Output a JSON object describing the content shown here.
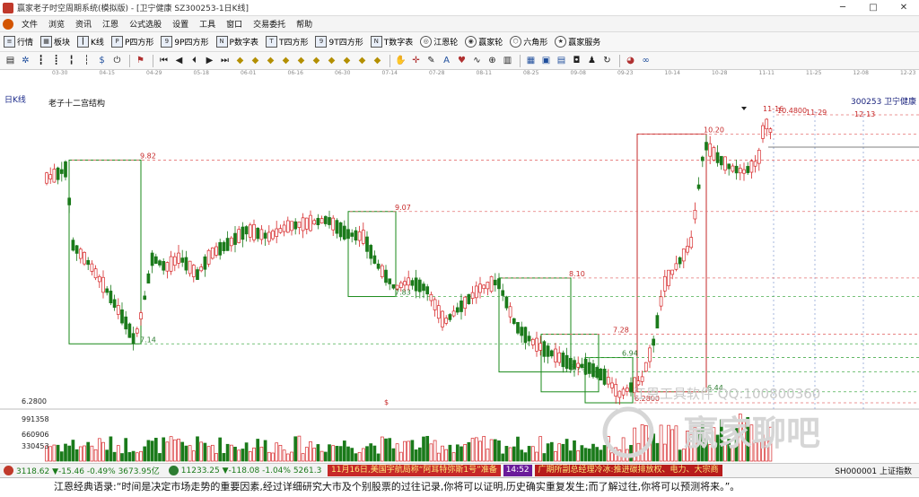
{
  "window": {
    "title": "赢家老子时空周期系统(模拟版) - [卫宁健康  SZ300253-1日K线]",
    "min_label": "─",
    "max_label": "□",
    "close_label": "✕"
  },
  "menu": [
    "文件",
    "浏览",
    "资讯",
    "江恩",
    "公式选股",
    "设置",
    "工具",
    "窗口",
    "交易委托",
    "帮助"
  ],
  "toolbar": [
    {
      "icon": "list-icon",
      "label": "行情"
    },
    {
      "icon": "grid-icon",
      "label": "板块"
    },
    {
      "icon": "candle-icon",
      "label": "K线"
    },
    {
      "icon": "p-box-icon",
      "label": "P四方形"
    },
    {
      "icon": "p9-box-icon",
      "label": "9P四方形"
    },
    {
      "icon": "pn-box-icon",
      "label": "P数字表"
    },
    {
      "icon": "t-box-icon",
      "label": "T四方形"
    },
    {
      "icon": "t9-box-icon",
      "label": "9T四方形"
    },
    {
      "icon": "tn-box-icon",
      "label": "T数字表"
    },
    {
      "icon": "gann-wheel-icon",
      "label": "江恩轮"
    },
    {
      "icon": "winner-wheel-icon",
      "label": "赢家轮"
    },
    {
      "icon": "hexagon-icon",
      "label": "六角形"
    },
    {
      "icon": "service-icon",
      "label": "赢家服务"
    }
  ],
  "chart_header": {
    "period_label": "日K线",
    "indicator_title": "老子十二宫结构",
    "stock_code": "300253",
    "stock_name": "卫宁健康",
    "vol_value": "6.2800"
  },
  "date_axis": [
    "03-30",
    "04-15",
    "04-29",
    "05-18",
    "06-01",
    "06-16",
    "06-30",
    "07-14",
    "07-28",
    "08-11",
    "08-25",
    "09-08",
    "09-23",
    "10-14",
    "10-28",
    "11-11",
    "11-25",
    "12-08",
    "12-23"
  ],
  "volume_axis": [
    "6.2800",
    "991358",
    "660906",
    "330453"
  ],
  "status": {
    "sh_index": "3118.62 ▼-15.46 -0.49% 3673.95亿",
    "sz_index": "11233.25 ▼-118.08 -1.04% 5261.3",
    "news_1": "11月16日,美国宇航局称“阿耳特弥斯1号”准备",
    "news_time": "14:52",
    "news_2": "广期所副总经理冷冰:推进碳排放权、电力、大宗商",
    "right": "SH000001 上证指数"
  },
  "quote": "江恩经典语录:“时间是决定市场走势的重要因素,经过详细研究大市及个别股票的过往记录,你将可以证明,历史确实重复发生;而了解过往,你将可以预测将来。”。",
  "watermark": {
    "top": "江恩工具软件  QQ:100800360",
    "brand": "赢家聊吧"
  },
  "chart_data": {
    "type": "candlestick",
    "series_color_up": "#d62728",
    "series_color_down": "#1a7a1a",
    "price_range": [
      6.28,
      10.9
    ],
    "boxes": [
      {
        "high": 9.82,
        "low": 7.14,
        "color": "#1a8a1a"
      },
      {
        "high": 9.07,
        "low": 7.83,
        "color": "#1a8a1a"
      },
      {
        "high": 8.1,
        "low": 6.73,
        "color": "#1a8a1a"
      },
      {
        "high": 7.28,
        "low": 6.44,
        "color": "#1a8a1a"
      },
      {
        "high": 6.94,
        "low": 6.28,
        "color": "#1a8a1a"
      },
      {
        "high": 10.2,
        "low": 6.44,
        "color": "#c62828"
      }
    ],
    "levels": [
      {
        "value": 9.82,
        "label": "9.82"
      },
      {
        "value": 9.07,
        "label": "9.07"
      },
      {
        "value": 8.1,
        "label": "8.10"
      },
      {
        "value": 7.28,
        "label": "7.28"
      },
      {
        "value": 7.14,
        "label": "7.14"
      },
      {
        "value": 6.94,
        "label": "6.94"
      },
      {
        "value": 6.73,
        "label": "6.73"
      },
      {
        "value": 7.83,
        "label": "7.83"
      },
      {
        "value": 6.44,
        "label": "6.44"
      },
      {
        "value": 6.28,
        "label": "6.2800"
      },
      {
        "value": 10.2,
        "label": "10.20"
      },
      {
        "value": 10.48,
        "label": "10.4800"
      }
    ],
    "top_right_dates": [
      "11-16",
      "11-29",
      "12-13"
    ]
  }
}
